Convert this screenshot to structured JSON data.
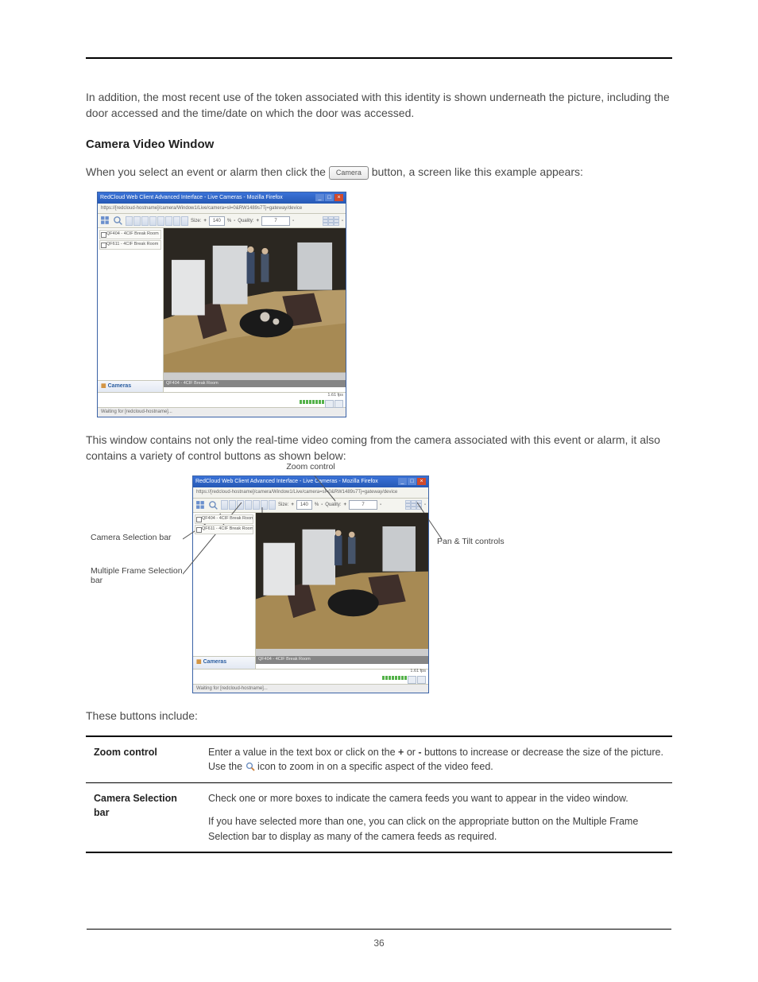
{
  "intro_paragraph": "In addition, the most recent use of the token associated with this identity is shown underneath the picture, including the door accessed and the time/date on which the door was accessed.",
  "heading": "Camera Video Window",
  "pre_button_text": "When you select an event or alarm then click the ",
  "camera_button_label": "Camera",
  "post_button_text": " button, a screen like this example appears:",
  "window": {
    "title": "RedCloud Web Client Advanced Interface - Live Cameras - Mozilla Firefox",
    "address": "https://[redcloud-hostname]/camera/Window1/Live/camera=sl=0&RW1489s7Tj=gateway/device",
    "size_label": "Size:",
    "size_value": "140",
    "pct_label": "%",
    "quality_label": "Quality:",
    "quality_value": "7",
    "cameras": [
      "QF404 - 4CIF Break Room",
      "QF611 - 4CIF Break Room"
    ],
    "cameras_bar": "Cameras",
    "video_caption": "QF404 - 4CIF Break Room",
    "fps": "1.61 fps",
    "status": "Waiting for [redcloud-hostname]..."
  },
  "after_first_shot": "This window contains not only the real-time video coming from the camera associated with this event or alarm, it also contains a variety of control buttons as shown below:",
  "diagram_labels": {
    "zoom": "Zoom control",
    "cam_sel": "Camera Selection bar",
    "multi": "Multiple Frame Selection bar",
    "pan_tilt": "Pan & Tilt controls"
  },
  "these_buttons": "These buttons include:",
  "table": {
    "rows": [
      {
        "name": "Zoom control",
        "desc_a": "Enter a value in the text box or click on the ",
        "plus": "+",
        "or": " or ",
        "minus": "-",
        "desc_b": " buttons to increase or decrease the size of the picture. Use the ",
        "desc_c": " icon to zoom in on a specific aspect of the video feed."
      },
      {
        "name": "Camera Selection bar",
        "p1": "Check one or more boxes to indicate the camera feeds you want to appear in the video window.",
        "p2": "If you have selected more than one, you can click on the appropriate button on the Multiple Frame Selection bar to display as many of the camera feeds as required."
      }
    ]
  },
  "page_number": "36"
}
